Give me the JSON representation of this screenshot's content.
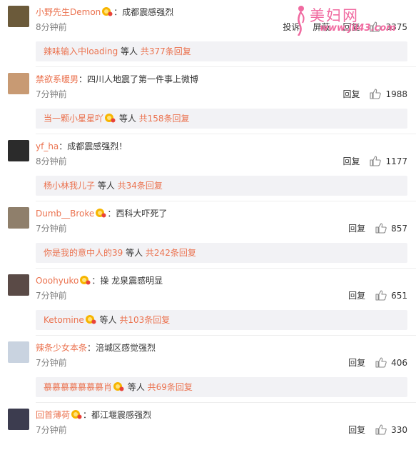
{
  "watermark": {
    "title": "美妇网",
    "url": "www.jil43.com"
  },
  "reply_label": "回复",
  "report_label": "投诉",
  "shield_label": "屏蔽",
  "comments": [
    {
      "username": "小野先生Demon",
      "has_vip": true,
      "text": "：成都震感强烈",
      "time": "8分钟前",
      "likes": "3375",
      "sub": {
        "user": "辣味输入中loading",
        "has_vip": false,
        "mid": " 等人 ",
        "total": "共377条回复"
      },
      "avatar_color": "#6b5a3a"
    },
    {
      "username": "禁欲系暖男",
      "has_vip": false,
      "text": "：四川人地震了第一件事上微博",
      "time": "7分钟前",
      "likes": "1988",
      "sub": {
        "user": "当一颗小星星吖",
        "has_vip": true,
        "mid": " 等人 ",
        "total": "共158条回复"
      },
      "avatar_color": "#c89a73"
    },
    {
      "username": "yf_ha",
      "has_vip": false,
      "text": "：成都震感强烈！",
      "time": "8分钟前",
      "likes": "1177",
      "sub": {
        "user": "杨小林我儿子",
        "has_vip": false,
        "mid": " 等人 ",
        "total": "共34条回复"
      },
      "avatar_color": "#2b2b2b"
    },
    {
      "username": "Dumb__Broke",
      "has_vip": true,
      "text": "：西科大吓死了",
      "time": "7分钟前",
      "likes": "857",
      "sub": {
        "user": "你是我的意中人的39",
        "has_vip": false,
        "mid": " 等人 ",
        "total": "共242条回复"
      },
      "avatar_color": "#8f7f6b"
    },
    {
      "username": "Ooohyuko",
      "has_vip": true,
      "text": "：操 龙泉震感明显",
      "time": "7分钟前",
      "likes": "651",
      "sub": {
        "user": "Ketomine",
        "has_vip": true,
        "mid": " 等人 ",
        "total": "共103条回复"
      },
      "avatar_color": "#5a4a46"
    },
    {
      "username": "辣条少女本条",
      "has_vip": false,
      "text": "：涪城区感觉强烈",
      "time": "7分钟前",
      "likes": "406",
      "sub": {
        "user": "慕慕慕慕慕慕慕肖",
        "has_vip": true,
        "mid": " 等人 ",
        "total": "共69条回复"
      },
      "avatar_color": "#c9d3e0"
    },
    {
      "username": "回首薄荷",
      "has_vip": true,
      "text": "：都江堰震感强烈",
      "time": "7分钟前",
      "likes": "330",
      "sub": null,
      "avatar_color": "#3c3c4f"
    }
  ]
}
